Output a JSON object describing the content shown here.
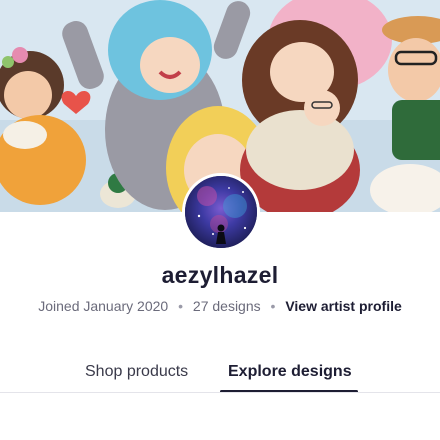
{
  "profile": {
    "username": "aezylhazel",
    "joined": "Joined January 2020",
    "design_count": "27 designs",
    "artist_link": "View artist profile",
    "separator": "•"
  },
  "tabs": [
    {
      "label": "Shop products",
      "active": false
    },
    {
      "label": "Explore designs",
      "active": true
    }
  ],
  "colors": {
    "text_primary": "#1d1d33",
    "text_secondary": "#6b6b7b",
    "tab_underline": "#1d1d33",
    "avatar_bg": "#2a2a6e"
  }
}
